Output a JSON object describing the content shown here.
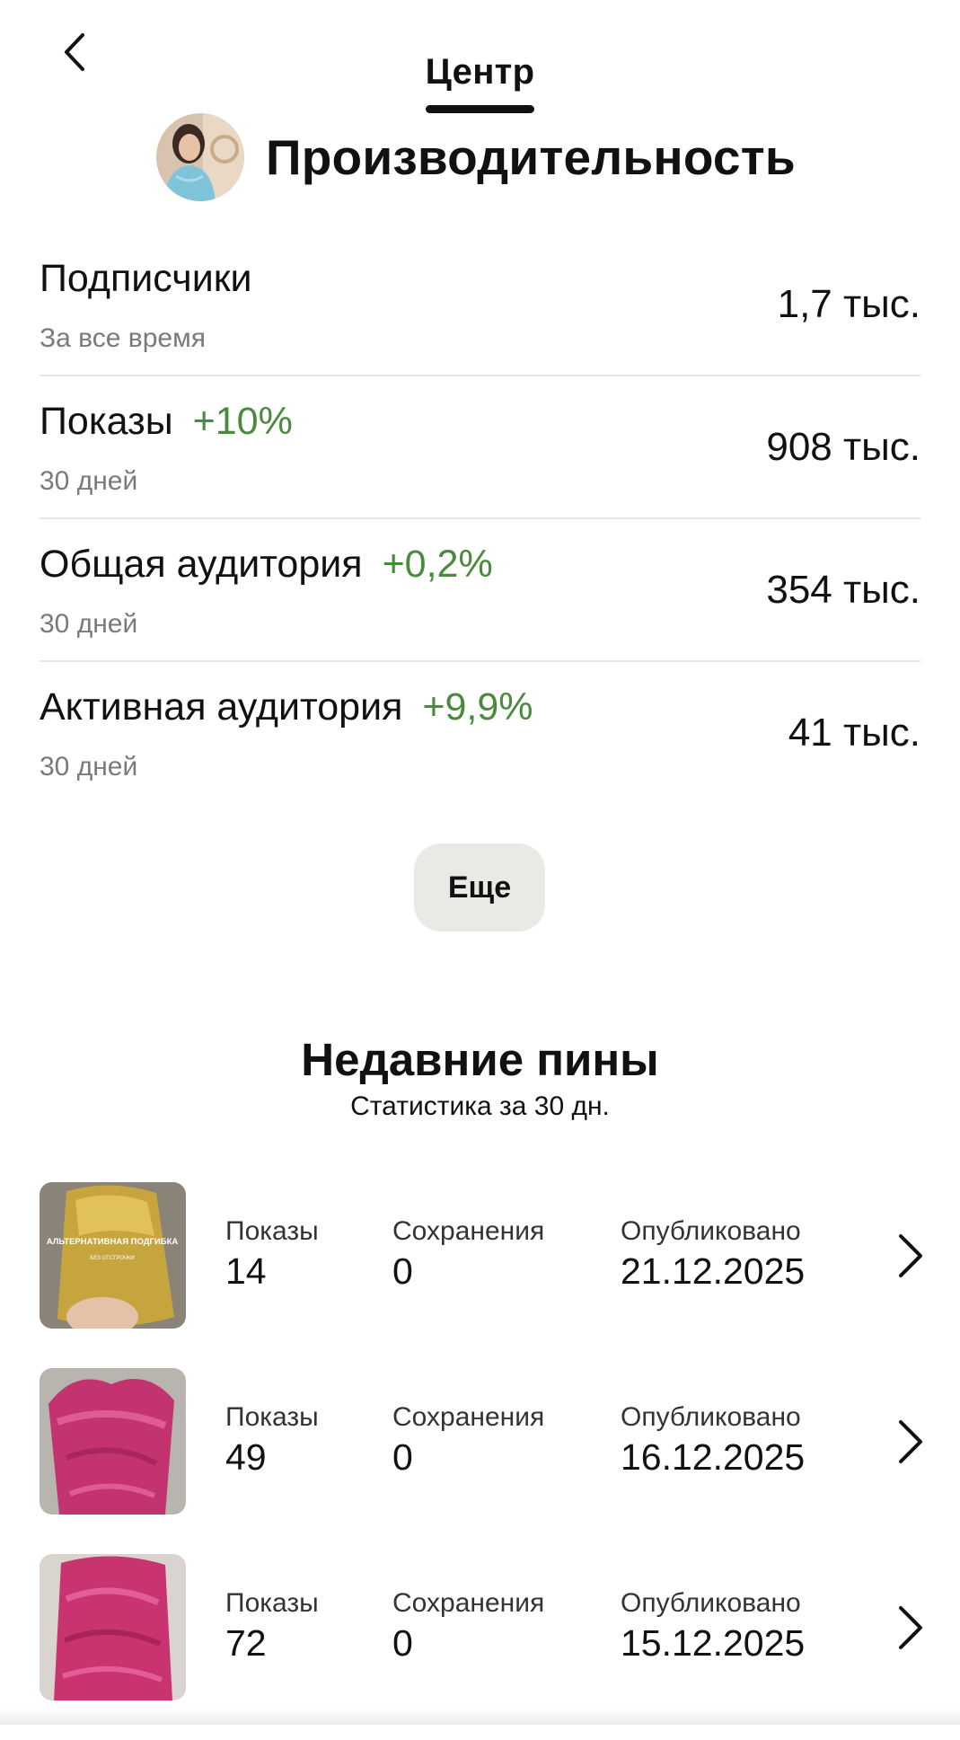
{
  "nav": {
    "back_icon": "chevron-left-icon",
    "tab_label": "Центр"
  },
  "header": {
    "title": "Производительность",
    "avatar_icon": "profile-avatar"
  },
  "colors": {
    "positive_change": "#4a8a3c",
    "muted_text": "#7a7a7a",
    "button_bg": "#e9e9e5"
  },
  "metrics": [
    {
      "name": "Подписчики",
      "change": "",
      "period": "За все время",
      "value": "1,7 тыс."
    },
    {
      "name": "Показы",
      "change": "+10%",
      "period": "30 дней",
      "value": "908 тыс."
    },
    {
      "name": "Общая аудитория",
      "change": "+0,2%",
      "period": "30 дней",
      "value": "354 тыс."
    },
    {
      "name": "Активная аудитория",
      "change": "+9,9%",
      "period": "30 дней",
      "value": "41 тыс."
    }
  ],
  "more_button": "Еще",
  "recent_pins": {
    "title": "Недавние пины",
    "subtitle": "Статистика за 30 дн.",
    "items": [
      {
        "impressions_label": "Показы",
        "impressions": "14",
        "saves_label": "Сохранения",
        "saves": "0",
        "published_label": "Опубликовано",
        "published": "21.12.2025",
        "thumb_text_1": "АЛЬТЕРНАТИВНАЯ ПОДГИБКА",
        "thumb_text_2": "БЕЗ ОТСТРОЧКИ"
      },
      {
        "impressions_label": "Показы",
        "impressions": "49",
        "saves_label": "Сохранения",
        "saves": "0",
        "published_label": "Опубликовано",
        "published": "16.12.2025"
      },
      {
        "impressions_label": "Показы",
        "impressions": "72",
        "saves_label": "Сохранения",
        "saves": "0",
        "published_label": "Опубликовано",
        "published": "15.12.2025"
      }
    ]
  }
}
